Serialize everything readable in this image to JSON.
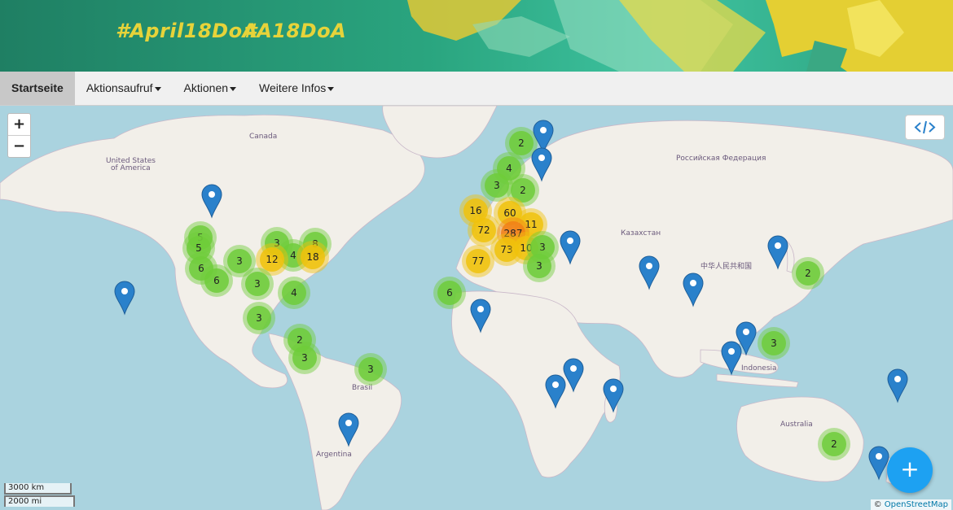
{
  "banner": {
    "tag1": "#April18DoA",
    "tag2": "#A18DoA"
  },
  "nav": {
    "items": [
      {
        "label": "Startseite"
      },
      {
        "label": "Aktionsaufruf"
      },
      {
        "label": "Aktionen"
      },
      {
        "label": "Weitere Infos"
      }
    ]
  },
  "map": {
    "zoom_in": "+",
    "zoom_out": "−",
    "embed_icon": "code-icon",
    "scale_km": "3000 km",
    "scale_mi": "2000 mi",
    "attribution_prefix": "©",
    "attribution_link": "OpenStreetMap",
    "fab": "+",
    "labels": {
      "canada": "Canada",
      "usa1": "United States",
      "usa2": "of America",
      "russia": "Российская Федерация",
      "kazakhstan": "Казахстан",
      "china": "中华人民共和国",
      "indonesia": "Indonesia",
      "brasil": "Brasil",
      "argentina": "Argentina",
      "australia": "Australia"
    },
    "clusters": [
      {
        "count": "2",
        "color": "green"
      },
      {
        "count": "4",
        "color": "green"
      },
      {
        "count": "3",
        "color": "green"
      },
      {
        "count": "2",
        "color": "green"
      },
      {
        "count": "16",
        "color": "yellow"
      },
      {
        "count": "60",
        "color": "yellow"
      },
      {
        "count": "11",
        "color": "yellow"
      },
      {
        "count": "72",
        "color": "yellow"
      },
      {
        "count": "287",
        "color": "orange"
      },
      {
        "count": "73",
        "color": "yellow"
      },
      {
        "count": "10",
        "color": "yellow"
      },
      {
        "count": "3",
        "color": "green"
      },
      {
        "count": "77",
        "color": "yellow"
      },
      {
        "count": "3",
        "color": "green"
      },
      {
        "count": "6",
        "color": "green"
      },
      {
        "count": "5",
        "color": "green"
      },
      {
        "count": "5",
        "color": "green"
      },
      {
        "count": "6",
        "color": "green"
      },
      {
        "count": "6",
        "color": "green"
      },
      {
        "count": "3",
        "color": "green"
      },
      {
        "count": "3",
        "color": "green"
      },
      {
        "count": "4",
        "color": "green"
      },
      {
        "count": "12",
        "color": "yellow"
      },
      {
        "count": "8",
        "color": "green"
      },
      {
        "count": "18",
        "color": "yellow"
      },
      {
        "count": "3",
        "color": "green"
      },
      {
        "count": "4",
        "color": "green"
      },
      {
        "count": "3",
        "color": "green"
      },
      {
        "count": "2",
        "color": "green"
      },
      {
        "count": "3",
        "color": "green"
      },
      {
        "count": "3",
        "color": "green"
      },
      {
        "count": "2",
        "color": "green"
      },
      {
        "count": "3",
        "color": "green"
      },
      {
        "count": "2",
        "color": "green"
      }
    ],
    "colors": {
      "water": "#aad3df",
      "land": "#f2efe9",
      "cluster_green": "#6ecc39",
      "cluster_yellow": "#f0c20c",
      "cluster_orange": "#f18017",
      "pin": "#2a81cb"
    }
  }
}
